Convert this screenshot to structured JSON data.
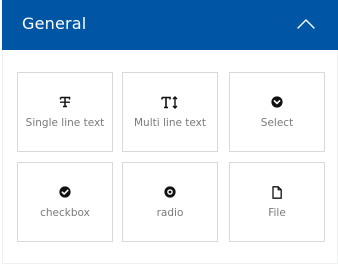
{
  "header": {
    "title": "General",
    "toggle_icon": "chevron-up-icon",
    "background": "#0055a5"
  },
  "fields": [
    {
      "label": "Single line text",
      "icon": "text-strikethrough-icon"
    },
    {
      "label": "Multi line text",
      "icon": "text-height-icon"
    },
    {
      "label": "Select",
      "icon": "circle-chevron-down-icon"
    },
    {
      "label": "checkbox",
      "icon": "circle-check-icon"
    },
    {
      "label": "radio",
      "icon": "radio-dot-icon"
    },
    {
      "label": "File",
      "icon": "file-icon"
    }
  ]
}
